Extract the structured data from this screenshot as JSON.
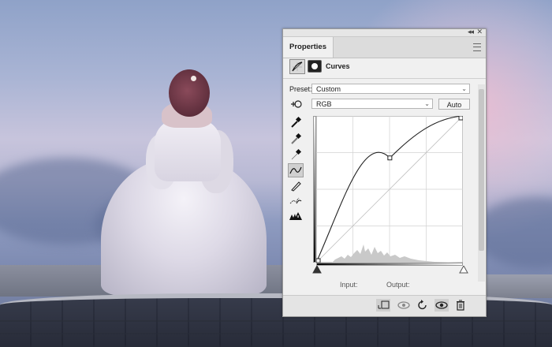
{
  "panel": {
    "tab_label": "Properties",
    "collapse_icon": "double-chevron-icon",
    "close_icon": "close-icon",
    "menu_icon": "hamburger-menu-icon",
    "adjustment_title": "Curves",
    "adjustment_icon": "curves-adjustment-icon",
    "mask_icon": "layer-mask-icon"
  },
  "preset": {
    "label": "Preset:",
    "value": "Custom"
  },
  "channel": {
    "value": "RGB",
    "auto_label": "Auto"
  },
  "tools": [
    "on-image-adjust-icon",
    "eyedropper-black-icon",
    "eyedropper-gray-icon",
    "eyedropper-white-icon",
    "curve-points-icon",
    "pencil-icon",
    "smooth-curve-icon",
    "clipping-warning-icon"
  ],
  "curve": {
    "points": [
      [
        0,
        0
      ],
      [
        128,
        182
      ],
      [
        255,
        255
      ]
    ]
  },
  "io": {
    "input_label": "Input:",
    "output_label": "Output:"
  },
  "bottom_bar": [
    "clip-to-layer-icon",
    "view-previous-state-icon",
    "reset-adjustments-icon",
    "toggle-visibility-icon",
    "delete-adjustment-icon"
  ]
}
